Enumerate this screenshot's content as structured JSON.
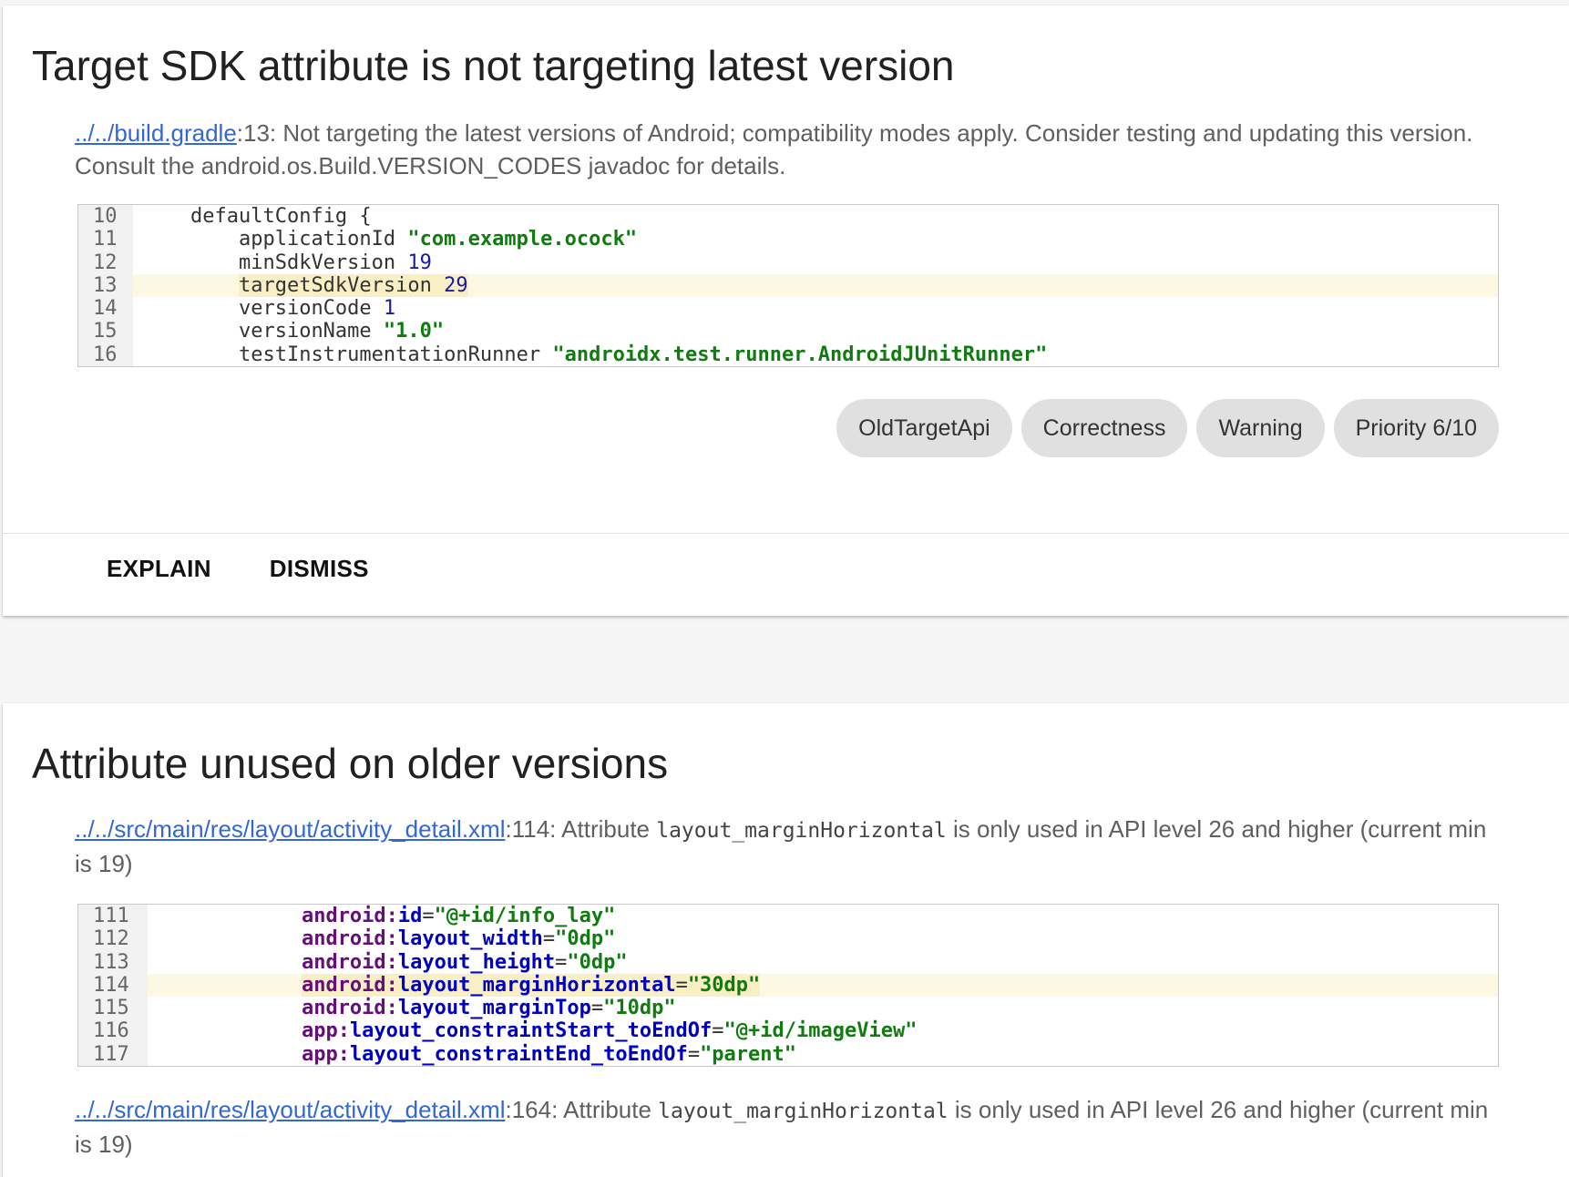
{
  "issues": [
    {
      "title": "Target SDK attribute is not targeting latest version",
      "location_link": "../../build.gradle",
      "location_line": ":13: ",
      "message": "Not targeting the latest versions of Android; compatibility modes apply. Consider testing and updating this version. Consult the android.os.Build.VERSION_CODES javadoc for details.",
      "code": {
        "lines": [
          {
            "no": "10",
            "indent": "    ",
            "tokens": [
              [
                "plain",
                "defaultConfig {"
              ]
            ]
          },
          {
            "no": "11",
            "indent": "        ",
            "tokens": [
              [
                "plain",
                "applicationId "
              ],
              [
                "kw-str",
                "\"com.example.ocock\""
              ]
            ]
          },
          {
            "no": "12",
            "indent": "        ",
            "tokens": [
              [
                "plain",
                "minSdkVersion "
              ],
              [
                "kw-num",
                "19"
              ]
            ]
          },
          {
            "no": "13",
            "indent": "        ",
            "highlight": true,
            "tokens": [
              [
                "plain",
                "targetSdkVersion "
              ],
              [
                "kw-num",
                "29"
              ]
            ]
          },
          {
            "no": "14",
            "indent": "        ",
            "tokens": [
              [
                "plain",
                "versionCode "
              ],
              [
                "kw-num",
                "1"
              ]
            ]
          },
          {
            "no": "15",
            "indent": "        ",
            "tokens": [
              [
                "plain",
                "versionName "
              ],
              [
                "kw-str",
                "\"1.0\""
              ]
            ]
          },
          {
            "no": "16",
            "indent": "        ",
            "tokens": [
              [
                "plain",
                "testInstrumentationRunner "
              ],
              [
                "kw-str",
                "\"androidx.test.runner.AndroidJUnitRunner\""
              ]
            ]
          }
        ]
      },
      "chips": [
        "OldTargetApi",
        "Correctness",
        "Warning",
        "Priority 6/10"
      ],
      "actions": {
        "explain": "EXPLAIN",
        "dismiss": "DISMISS"
      }
    },
    {
      "title": "Attribute unused on older versions",
      "warnings": [
        {
          "location_link": "../../src/main/res/layout/activity_detail.xml",
          "location_line": ":114: ",
          "message_pre": "Attribute ",
          "message_code": "layout_marginHorizontal",
          "message_post": " is only used in API level 26 and higher (current min is 19)"
        },
        {
          "location_link": "../../src/main/res/layout/activity_detail.xml",
          "location_line": ":164: ",
          "message_pre": "Attribute ",
          "message_code": "layout_marginHorizontal",
          "message_post": " is only used in API level 26 and higher (current min is 19)"
        }
      ],
      "code": {
        "lines": [
          {
            "no": "111",
            "indent": "            ",
            "tokens": [
              [
                "kw-ns",
                "android:"
              ],
              [
                "kw-attr",
                "id"
              ],
              [
                "plain",
                "="
              ],
              [
                "kw-val",
                "\"@+id/info_lay\""
              ]
            ]
          },
          {
            "no": "112",
            "indent": "            ",
            "tokens": [
              [
                "kw-ns",
                "android:"
              ],
              [
                "kw-attr",
                "layout_width"
              ],
              [
                "plain",
                "="
              ],
              [
                "kw-val",
                "\"0dp\""
              ]
            ]
          },
          {
            "no": "113",
            "indent": "            ",
            "tokens": [
              [
                "kw-ns",
                "android:"
              ],
              [
                "kw-attr",
                "layout_height"
              ],
              [
                "plain",
                "="
              ],
              [
                "kw-val",
                "\"0dp\""
              ]
            ]
          },
          {
            "no": "114",
            "indent": "            ",
            "highlight": true,
            "tokens": [
              [
                "kw-ns",
                "android:"
              ],
              [
                "kw-attr",
                "layout_marginHorizontal"
              ],
              [
                "plain",
                "="
              ],
              [
                "kw-val",
                "\"30dp\""
              ]
            ]
          },
          {
            "no": "115",
            "indent": "            ",
            "tokens": [
              [
                "kw-ns",
                "android:"
              ],
              [
                "kw-attr",
                "layout_marginTop"
              ],
              [
                "plain",
                "="
              ],
              [
                "kw-val",
                "\"10dp\""
              ]
            ]
          },
          {
            "no": "116",
            "indent": "            ",
            "tokens": [
              [
                "kw-ns",
                "app:"
              ],
              [
                "kw-attr",
                "layout_constraintStart_toEndOf"
              ],
              [
                "plain",
                "="
              ],
              [
                "kw-val",
                "\"@+id/imageView\""
              ]
            ]
          },
          {
            "no": "117",
            "indent": "            ",
            "tokens": [
              [
                "kw-ns",
                "app:"
              ],
              [
                "kw-attr",
                "layout_constraintEnd_toEndOf"
              ],
              [
                "plain",
                "="
              ],
              [
                "kw-val",
                "\"parent\""
              ]
            ]
          }
        ]
      }
    }
  ]
}
